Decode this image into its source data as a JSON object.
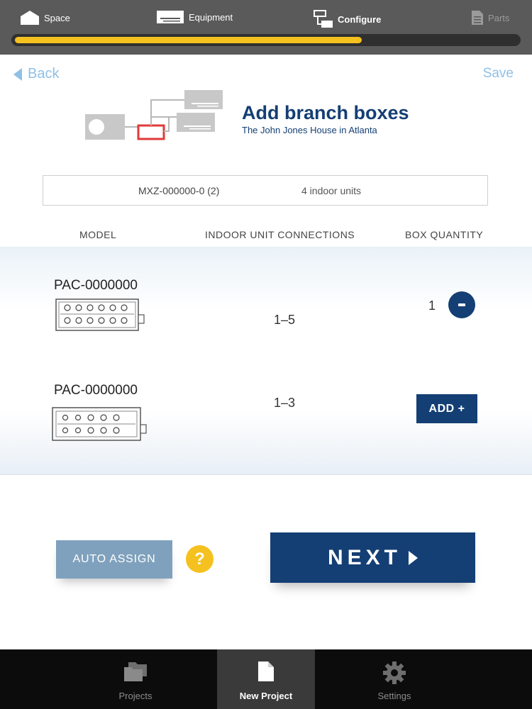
{
  "progress": {
    "steps": [
      {
        "label": "Space",
        "icon": "house-icon"
      },
      {
        "label": "Equipment",
        "icon": "equipment-icon"
      },
      {
        "label": "Configure",
        "icon": "configure-icon"
      },
      {
        "label": "Parts",
        "icon": "document-icon"
      }
    ],
    "current_step": "Configure",
    "fill_fraction": 0.69,
    "colors": {
      "fill": "#f4c11f",
      "track": "#2f2f2f"
    }
  },
  "nav": {
    "back_label": "Back",
    "save_label": "Save"
  },
  "header": {
    "title": "Add branch boxes",
    "subtitle": "The John Jones House in Atlanta"
  },
  "summary": {
    "model_count": "MXZ-000000-0 (2)",
    "indoor_units": "4 indoor units"
  },
  "table": {
    "columns": [
      "MODEL",
      "INDOOR UNIT CONNECTIONS",
      "BOX QUANTITY"
    ],
    "rows": [
      {
        "model": "PAC-0000000",
        "connections": "1–5",
        "quantity": "1",
        "action": "-"
      },
      {
        "model": "PAC-0000000",
        "connections": "1–3",
        "quantity": "",
        "action": "ADD +"
      }
    ]
  },
  "actions": {
    "auto_assign_label": "AUTO ASSIGN",
    "help_label": "?",
    "next_label": "NEXT"
  },
  "tabbar": {
    "tabs": [
      {
        "label": "Projects",
        "icon": "folders-icon"
      },
      {
        "label": "New Project",
        "icon": "new-document-icon"
      },
      {
        "label": "Settings",
        "icon": "gear-icon"
      }
    ],
    "active": "New Project"
  },
  "colors": {
    "brand": "#143f74",
    "accent": "#f4c11f",
    "link": "#8fc0e6",
    "auto_assign": "#7fa1bd"
  }
}
